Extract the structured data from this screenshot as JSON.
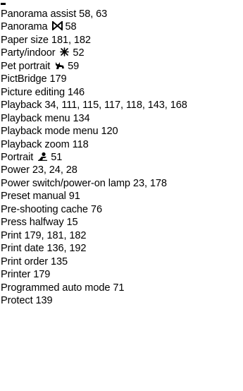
{
  "index": {
    "entries": [
      {
        "term": "Panorama assist",
        "pages": "58, 63"
      },
      {
        "term": "Panorama",
        "icon": "panorama-bowtie-icon",
        "pages": "58"
      },
      {
        "term": "Paper size",
        "pages": "181, 182"
      },
      {
        "term": "Party/indoor",
        "icon": "party-indoor-icon",
        "pages": "52"
      },
      {
        "term": "Pet portrait",
        "icon": "pet-portrait-icon",
        "pages": "59"
      },
      {
        "term": "PictBridge",
        "pages": "179"
      },
      {
        "term": "Picture editing",
        "pages": "146"
      },
      {
        "term": "Playback",
        "pages": "34, 111, 115, 117, 118, 143, 168"
      },
      {
        "term": "Playback menu",
        "pages": "134"
      },
      {
        "term": "Playback mode menu",
        "pages": "120"
      },
      {
        "term": "Playback zoom",
        "pages": "118"
      },
      {
        "term": "Portrait",
        "icon": "portrait-icon",
        "pages": "51"
      },
      {
        "term": "Power",
        "pages": "23, 24, 28"
      },
      {
        "term": "Power switch/power-on lamp",
        "pages": "23, 178"
      },
      {
        "term": "Preset manual",
        "pages": "91"
      },
      {
        "term": "Pre-shooting cache",
        "pages": "76"
      },
      {
        "term": "Press halfway",
        "pages": "15"
      },
      {
        "term": "Print",
        "pages": "179, 181, 182"
      },
      {
        "term": "Print date",
        "pages": "136, 192"
      },
      {
        "term": "Print order",
        "pages": "135"
      },
      {
        "term": "Printer",
        "pages": "179"
      },
      {
        "term": "Programmed auto mode",
        "pages": "71"
      },
      {
        "term": "Protect",
        "pages": "139"
      }
    ]
  }
}
